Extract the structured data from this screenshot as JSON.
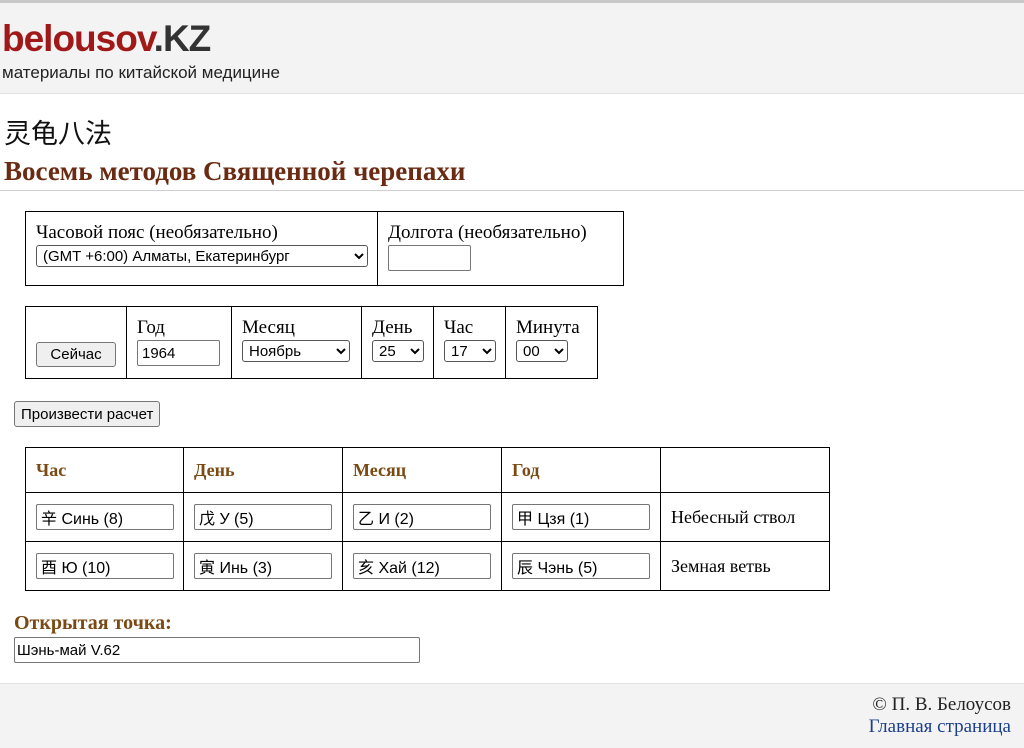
{
  "header": {
    "logo_main": "belousov",
    "logo_domain": ".KZ",
    "tagline": "материалы по китайской медицине"
  },
  "page": {
    "title_cn": "灵龟八法",
    "title_ru": "Восемь методов Священной черепахи"
  },
  "timezone_form": {
    "timezone_label": "Часовой пояс (необязательно)",
    "timezone_value": "(GMT +6:00) Алматы, Екатеринбург",
    "longitude_label": "Долгота (необязательно)",
    "longitude_value": ""
  },
  "datetime_form": {
    "now_button": "Сейчас",
    "year_label": "Год",
    "year_value": "1964",
    "month_label": "Месяц",
    "month_value": "Ноябрь",
    "day_label": "День",
    "day_value": "25",
    "hour_label": "Час",
    "hour_value": "17",
    "minute_label": "Минута",
    "minute_value": "00"
  },
  "calculate_button": "Произвести расчет",
  "results": {
    "columns": [
      "Час",
      "День",
      "Месяц",
      "Год",
      ""
    ],
    "stem_row": {
      "label": "Небесный ствол",
      "values": [
        "辛 Синь (8)",
        "戊 У (5)",
        "乙 И (2)",
        "甲 Цзя (1)"
      ]
    },
    "branch_row": {
      "label": "Земная ветвь",
      "values": [
        "酉 Ю (10)",
        "寅 Инь (3)",
        "亥 Хай (12)",
        "辰 Чэнь (5)"
      ]
    }
  },
  "open_point": {
    "label": "Открытая точка:",
    "value": "Шэнь-май V.62"
  },
  "footer": {
    "copyright": "© П. В. Белоусов",
    "home_link": "Главная страница"
  },
  "colors": {
    "logo_red": "#a01818",
    "title_brown": "#6b2a12",
    "label_brown": "#7a4a14",
    "link_blue": "#1c3f8c"
  }
}
